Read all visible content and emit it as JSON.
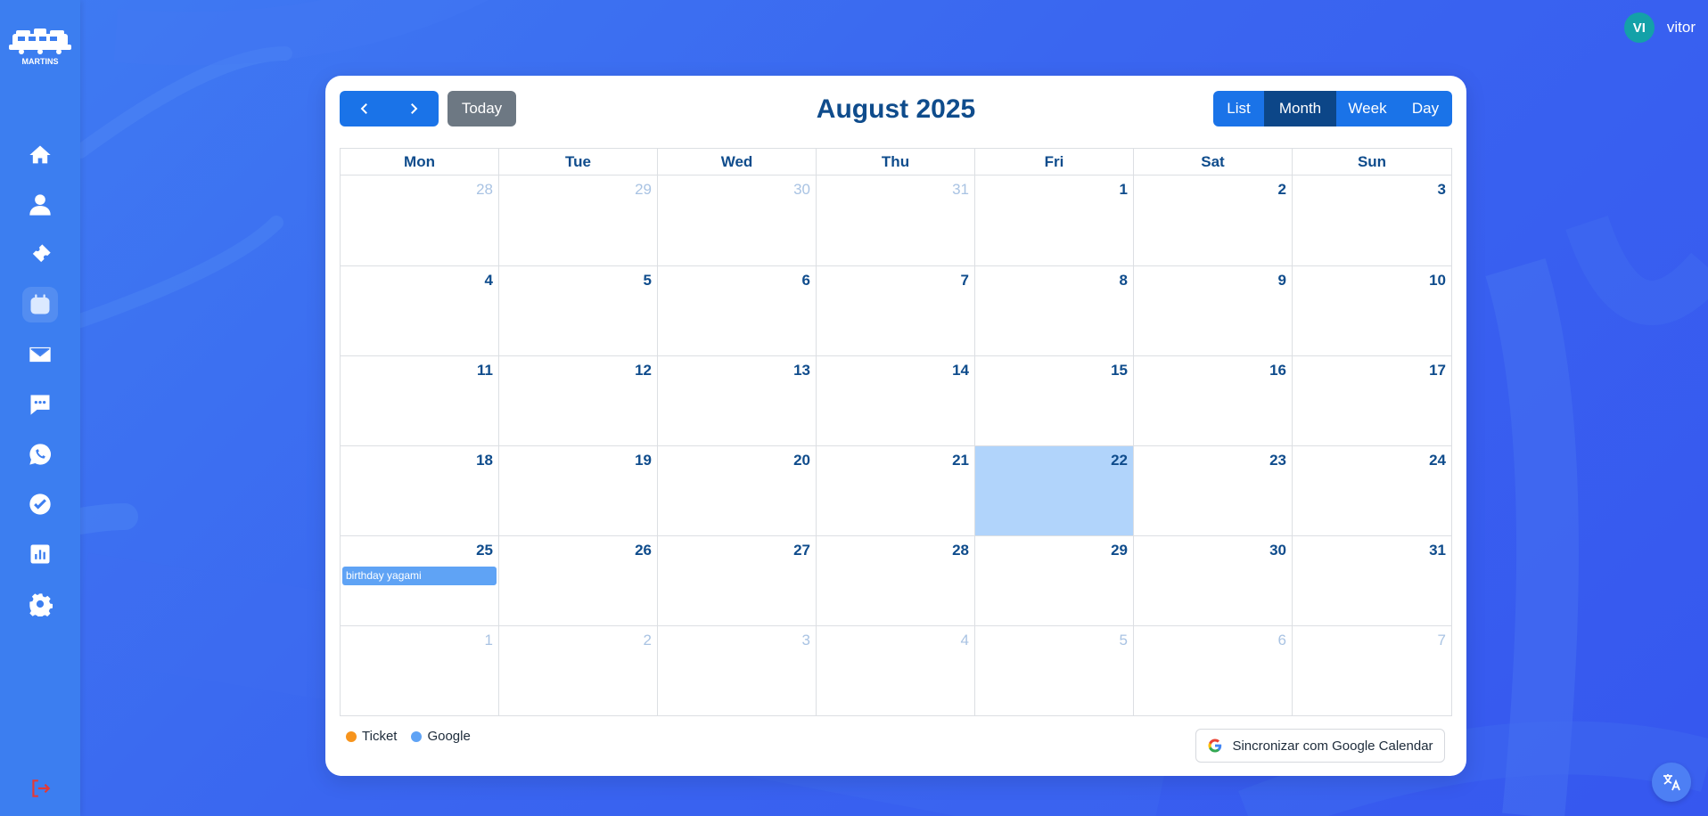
{
  "sidebar": {
    "logo_text": "MARTINS",
    "nav": [
      {
        "icon": "home-icon"
      },
      {
        "icon": "user-icon"
      },
      {
        "icon": "ticket-icon"
      },
      {
        "icon": "calendar-icon",
        "active": true
      },
      {
        "icon": "mail-icon"
      },
      {
        "icon": "chat-icon"
      },
      {
        "icon": "whatsapp-icon"
      },
      {
        "icon": "check-circle-icon"
      },
      {
        "icon": "chart-icon"
      },
      {
        "icon": "settings-icon"
      }
    ],
    "logout_icon": "logout-icon"
  },
  "user": {
    "initials": "VI",
    "name": "vitor"
  },
  "calendar": {
    "title": "August 2025",
    "today_label": "Today",
    "views": [
      {
        "label": "List",
        "active": false
      },
      {
        "label": "Month",
        "active": true
      },
      {
        "label": "Week",
        "active": false
      },
      {
        "label": "Day",
        "active": false
      }
    ],
    "weekdays": [
      "Mon",
      "Tue",
      "Wed",
      "Thu",
      "Fri",
      "Sat",
      "Sun"
    ],
    "weeks": [
      [
        {
          "d": "28",
          "other": true
        },
        {
          "d": "29",
          "other": true
        },
        {
          "d": "30",
          "other": true
        },
        {
          "d": "31",
          "other": true
        },
        {
          "d": "1"
        },
        {
          "d": "2"
        },
        {
          "d": "3"
        }
      ],
      [
        {
          "d": "4"
        },
        {
          "d": "5"
        },
        {
          "d": "6"
        },
        {
          "d": "7"
        },
        {
          "d": "8"
        },
        {
          "d": "9"
        },
        {
          "d": "10"
        }
      ],
      [
        {
          "d": "11"
        },
        {
          "d": "12"
        },
        {
          "d": "13"
        },
        {
          "d": "14"
        },
        {
          "d": "15"
        },
        {
          "d": "16"
        },
        {
          "d": "17"
        }
      ],
      [
        {
          "d": "18"
        },
        {
          "d": "19"
        },
        {
          "d": "20"
        },
        {
          "d": "21"
        },
        {
          "d": "22",
          "today": true
        },
        {
          "d": "23"
        },
        {
          "d": "24"
        }
      ],
      [
        {
          "d": "25",
          "event": "birthday yagami"
        },
        {
          "d": "26"
        },
        {
          "d": "27"
        },
        {
          "d": "28"
        },
        {
          "d": "29"
        },
        {
          "d": "30"
        },
        {
          "d": "31"
        }
      ],
      [
        {
          "d": "1",
          "other": true
        },
        {
          "d": "2",
          "other": true
        },
        {
          "d": "3",
          "other": true
        },
        {
          "d": "4",
          "other": true
        },
        {
          "d": "5",
          "other": true
        },
        {
          "d": "6",
          "other": true
        },
        {
          "d": "7",
          "other": true
        }
      ]
    ]
  },
  "legend": [
    {
      "label": "Ticket",
      "color": "#f7941d"
    },
    {
      "label": "Google",
      "color": "#5fa3f5"
    }
  ],
  "sync_button": {
    "label": "Sincronizar com Google Calendar",
    "icon": "google-icon"
  },
  "translate_icon": "translate-icon",
  "colors": {
    "accent": "#1a73e8",
    "active_view": "#0c4688",
    "today_bg": "#b1d4fb",
    "event_bg": "#5fa3f5"
  }
}
